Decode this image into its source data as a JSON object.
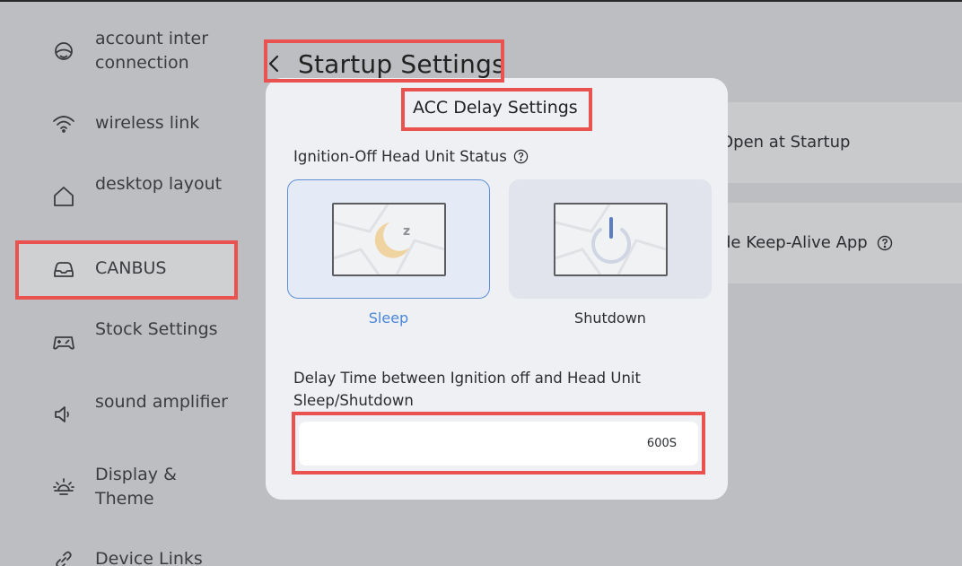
{
  "sidebar": {
    "items": [
      {
        "label": "account inter connection",
        "icon": "account-link-icon"
      },
      {
        "label": "wireless link",
        "icon": "wifi-icon"
      },
      {
        "label": "desktop layout",
        "icon": "home-icon"
      },
      {
        "label": "CANBUS",
        "icon": "car-icon",
        "active": true
      },
      {
        "label": "Stock Settings",
        "icon": "gamepad-icon"
      },
      {
        "label": "sound amplifier",
        "icon": "speaker-icon"
      },
      {
        "label": "Display & Theme",
        "icon": "sun-icon"
      },
      {
        "label": "Device Links",
        "icon": "link-icon"
      }
    ]
  },
  "header": {
    "title": "Startup Settings",
    "back_icon": "chevron-left-icon"
  },
  "background_rows": [
    {
      "label": "Open at Startup"
    },
    {
      "label": "de Keep-Alive App"
    }
  ],
  "dialog": {
    "title": "ACC Delay Settings",
    "status_label": "Ignition-Off Head Unit Status",
    "options": [
      {
        "label": "Sleep",
        "selected": true,
        "icon": "moon-icon"
      },
      {
        "label": "Shutdown",
        "selected": false,
        "icon": "power-icon"
      }
    ],
    "delay_label": "Delay Time between Ignition off and Head Unit Sleep/Shutdown",
    "delay_value": "600S"
  },
  "colors": {
    "background": "#bdbec1",
    "highlight": "#e9524f",
    "accent": "#4a86d8",
    "moon": "#efd3a0"
  }
}
